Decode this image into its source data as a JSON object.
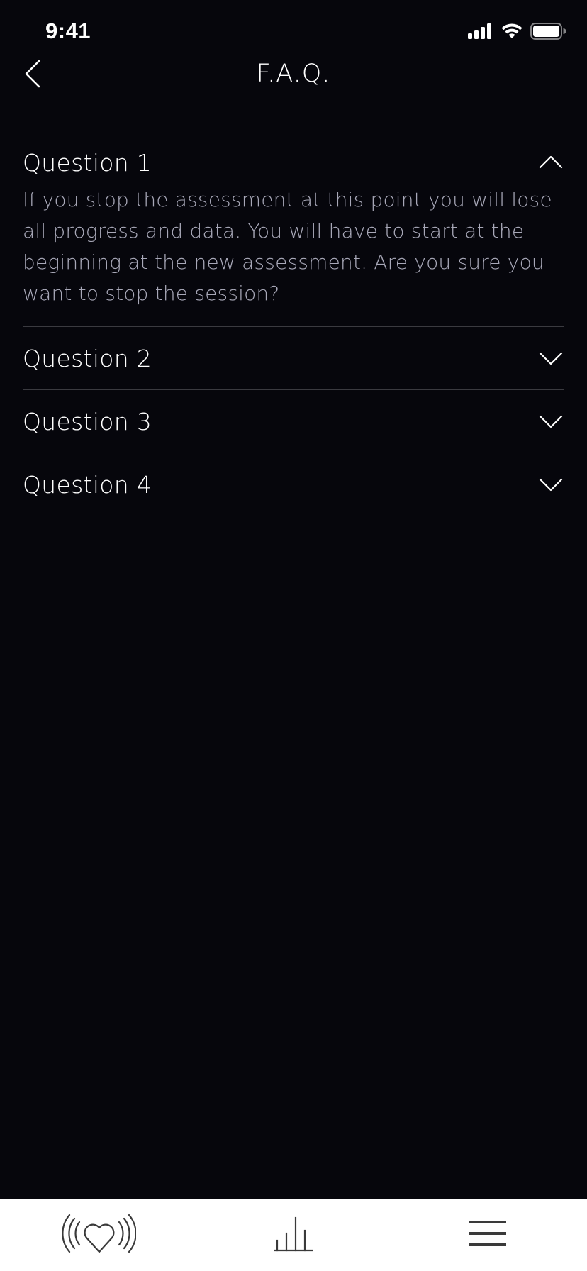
{
  "status_bar": {
    "time": "9:41",
    "icons": [
      "cellular-signal-icon",
      "wifi-icon",
      "battery-icon"
    ]
  },
  "nav": {
    "title": "F.A.Q.",
    "back_icon": "chevron-left-icon"
  },
  "faq": {
    "items": [
      {
        "question": "Question 1",
        "expanded": true,
        "answer": "If you stop the assessment at this point you will lose all progress and data. You will have to start at the beginning at the new assessment. Are you sure you want to stop the session?"
      },
      {
        "question": "Question 2",
        "expanded": false
      },
      {
        "question": "Question 3",
        "expanded": false
      },
      {
        "question": "Question 4",
        "expanded": false
      }
    ]
  },
  "tab_bar": {
    "items": [
      {
        "icon": "heart-pulse-icon"
      },
      {
        "icon": "bar-chart-icon"
      },
      {
        "icon": "menu-icon"
      }
    ]
  },
  "colors": {
    "background": "#06060c",
    "text_primary": "#ffffff",
    "text_secondary": "#a8a8b8",
    "divider": "#3a3a40",
    "tab_bar_background": "#ffffff",
    "tab_icon": "#3a3a3a"
  }
}
